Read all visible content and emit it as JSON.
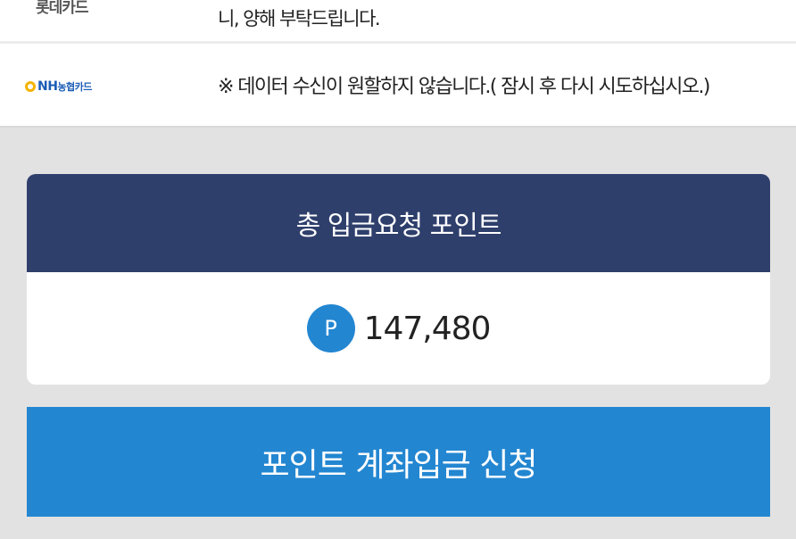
{
  "cards": [
    {
      "logo": "롯데카드",
      "message_top": "",
      "message": "니, 양해 부탁드립니다."
    },
    {
      "logo_main": "NH",
      "logo_sub": "농협카드",
      "message": "※ 데이터 수신이 원할하지 않습니다.( 잠시 후 다시 시도하십시오.)"
    }
  ],
  "point_summary": {
    "title": "총 입금요청 포인트",
    "badge": "P",
    "value": "147,480"
  },
  "submit_button": {
    "label": "포인트 계좌입금 신청"
  },
  "colors": {
    "header_navy": "#2f3f6c",
    "accent_blue": "#2386d1",
    "background_gray": "#e2e2e2",
    "nh_blue": "#1b5db6",
    "nh_yellow": "#f4b400"
  }
}
